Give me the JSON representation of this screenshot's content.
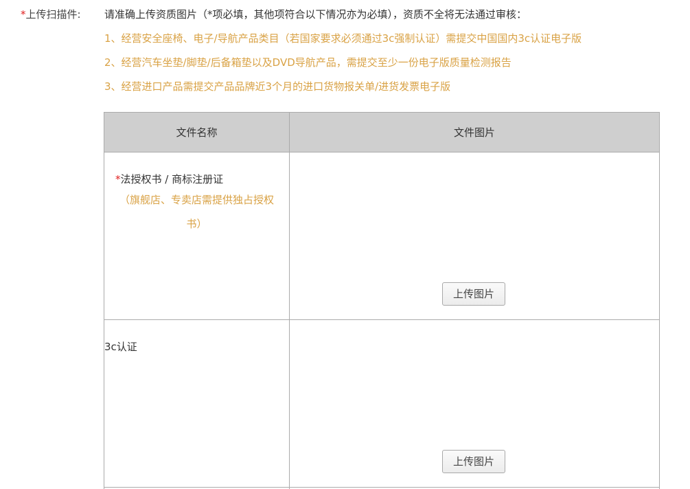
{
  "form": {
    "required_mark": "*",
    "label": "上传扫描件:",
    "intro": "请准确上传资质图片（*项必填，其他项符合以下情况亦为必填），资质不全将无法通过审核：",
    "requirements": [
      "1、经营安全座椅、电子/导航产品类目（若国家要求必须通过3c强制认证）需提交中国国内3c认证电子版",
      "2、经营汽车坐垫/脚垫/后备箱垫以及DVD导航产品，需提交至少一份电子版质量检测报告",
      "3、经营进口产品需提交产品品牌近3个月的进口货物报关单/进货发票电子版"
    ]
  },
  "table": {
    "headers": [
      "文件名称",
      "文件图片"
    ],
    "rows": [
      {
        "required_mark": "*",
        "name": "法授权书 / 商标注册证",
        "note": "（旗舰店、专卖店需提供独占授权书）",
        "upload_label": "上传图片"
      },
      {
        "name": "3c认证",
        "upload_label": "上传图片"
      }
    ]
  },
  "colors": {
    "required": "#e02020",
    "note": "#d9a245",
    "header_bg": "#cfcfcf"
  }
}
